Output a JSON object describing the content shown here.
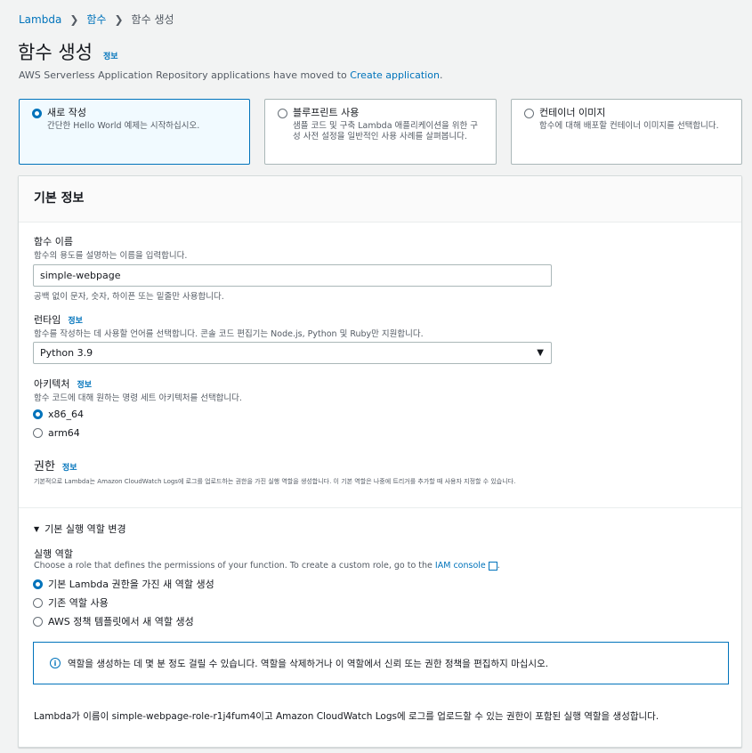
{
  "breadcrumb": {
    "root": "Lambda",
    "parent": "함수",
    "current": "함수 생성"
  },
  "page": {
    "title": "함수 생성",
    "info_link": "정보",
    "notice_prefix": "AWS Serverless Application Repository applications have moved to ",
    "notice_link": "Create application",
    "notice_suffix": "."
  },
  "tiles": [
    {
      "title": "새로 작성",
      "desc": "간단한 Hello World 예제는 시작하십시오.",
      "selected": true
    },
    {
      "title": "블루프린트 사용",
      "desc": "샘플 코드 및 구축 Lambda 애플리케이션을 위한 구성 사전 설정을 일반적인 사용 사례를 살펴봅니다.",
      "selected": false
    },
    {
      "title": "컨테이너 이미지",
      "desc": "함수에 대해 배포할 컨테이너 이미지를 선택합니다.",
      "selected": false
    }
  ],
  "basic": {
    "header": "기본 정보",
    "function_name": {
      "label": "함수 이름",
      "desc": "함수의 용도를 설명하는 이름을 입력합니다.",
      "value": "simple-webpage",
      "hint": "공백 없이 문자, 숫자, 하이픈 또는 밑줄만 사용합니다."
    },
    "runtime": {
      "label": "런타임",
      "info": "정보",
      "desc": "함수를 작성하는 데 사용할 언어를 선택합니다. 콘솔 코드 편집기는 Node.js, Python 및 Ruby만 지원합니다.",
      "value": "Python 3.9"
    },
    "architecture": {
      "label": "아키텍처",
      "info": "정보",
      "desc": "함수 코드에 대해 원하는 명령 세트 아키텍처를 선택합니다.",
      "options": [
        "x86_64",
        "arm64"
      ],
      "selected": "x86_64"
    },
    "permissions": {
      "label": "권한",
      "info": "정보",
      "desc": "기본적으로 Lambda는 Amazon CloudWatch Logs에 로그를 업로드하는 권한을 가진 실행 역할을 생성합니다. 이 기본 역할은 나중에 트리거를 추가할 때 사용자 지정할 수 있습니다."
    },
    "role_section": {
      "toggle": "기본 실행 역할 변경",
      "label": "실행 역할",
      "desc_prefix": "Choose a role that defines the permissions of your function. To create a custom role, go to the ",
      "desc_link": "IAM console",
      "options": [
        "기본 Lambda 권한을 가진 새 역할 생성",
        "기존 역할 사용",
        "AWS 정책 템플릿에서 새 역할 생성"
      ],
      "selected": "기본 Lambda 권한을 가진 새 역할 생성",
      "alert": "역할을 생성하는 데 몇 분 정도 걸릴 수 있습니다. 역할을 삭제하거나 이 역할에서 신뢰 또는 권한 정책을 편집하지 마십시오.",
      "summary": "Lambda가 이름이 simple-webpage-role-r1j4fum4이고 Amazon CloudWatch Logs에 로그를 업로드할 수 있는 권한이 포함된 실행 역할을 생성합니다."
    }
  }
}
